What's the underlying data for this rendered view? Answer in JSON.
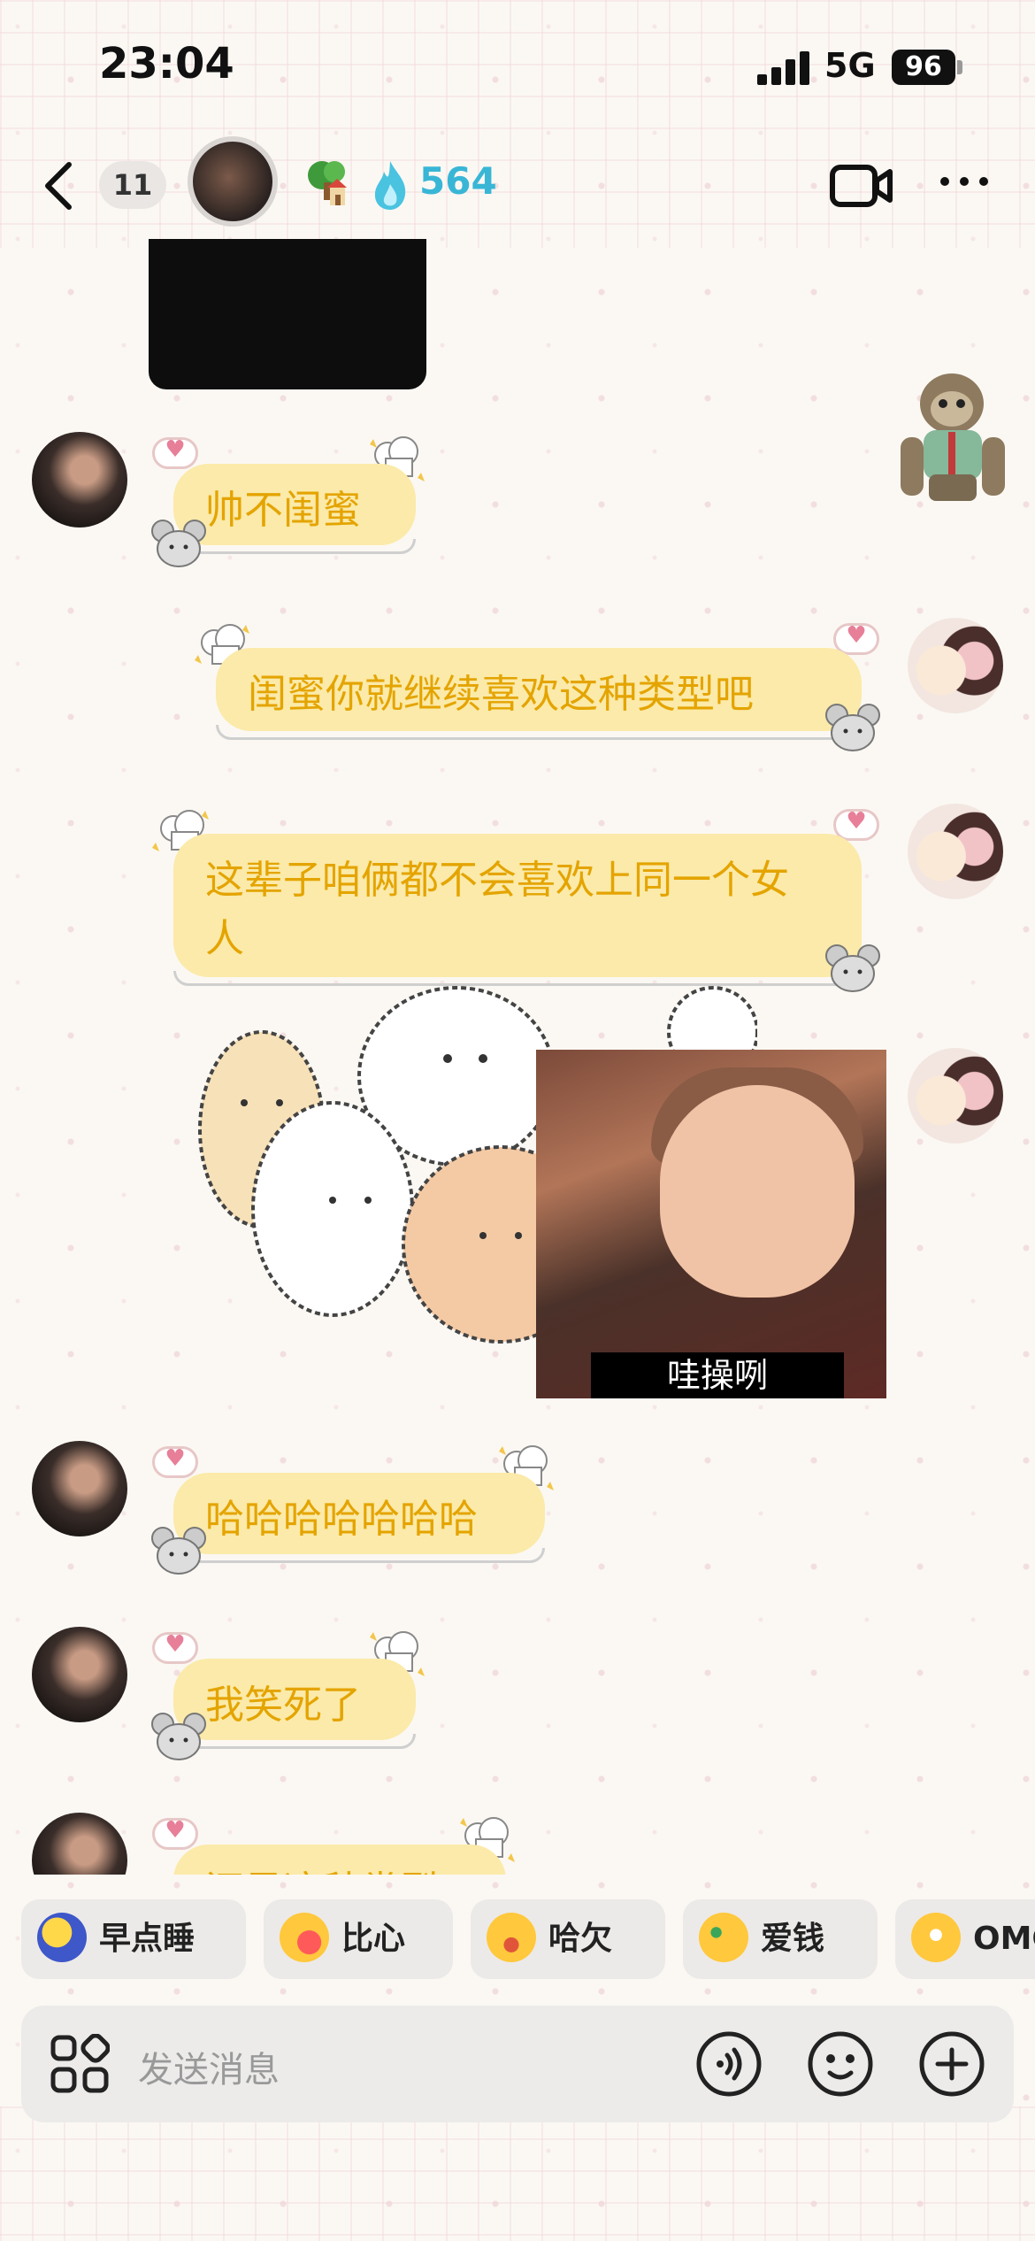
{
  "status_bar": {
    "time": "23:04",
    "network": "5G",
    "battery": "96"
  },
  "header": {
    "unread_count": "11",
    "fire_count": "564"
  },
  "messages": [
    {
      "side": "left",
      "text": "帅不闺蜜"
    },
    {
      "side": "right",
      "text": "闺蜜你就继续喜欢这种类型吧"
    },
    {
      "side": "right",
      "text": "这辈子咱俩都不会喜欢上同一个女人"
    },
    {
      "side": "right",
      "meme_caption": "哇操咧"
    },
    {
      "side": "left",
      "text": "哈哈哈哈哈哈哈"
    },
    {
      "side": "left",
      "text": "我笑死了"
    },
    {
      "side": "left",
      "text": "还是这种类型"
    }
  ],
  "quick_replies": [
    {
      "label": "早点睡",
      "icon": "sleepy-moon-icon"
    },
    {
      "label": "比心",
      "icon": "heart-hands-icon"
    },
    {
      "label": "哈欠",
      "icon": "yawn-face-icon"
    },
    {
      "label": "爱钱",
      "icon": "money-face-icon"
    },
    {
      "label": "OMG",
      "icon": "flushed-face-icon"
    }
  ],
  "input": {
    "placeholder": "发送消息"
  },
  "colors": {
    "bubble": "#fbeaa9",
    "bubble_text": "#e4a400",
    "accent_fire": "#39b6d6"
  }
}
